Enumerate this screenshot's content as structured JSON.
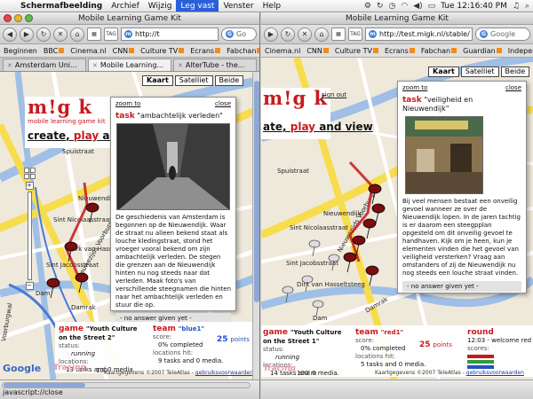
{
  "menubar": {
    "app": "Schermafbeelding",
    "items": [
      "Archief",
      "Wijzig",
      "Leg vast",
      "Venster",
      "Help"
    ],
    "active": "Leg vast",
    "clock": "Tue 12:16:40 PM"
  },
  "left_window": {
    "title": "Mobile Learning Game Kit",
    "url": "http://t",
    "search_placeholder": "Go",
    "bookmarks": [
      "Beginnen",
      "BBC",
      "Cinema.nl",
      "CNN",
      "Culture TV",
      "Ecrans",
      "Fabchan"
    ],
    "tabs": [
      "Amsterdam Uni...",
      "Mobile Learning...",
      "AlterTube - the..."
    ],
    "map_types": [
      "Kaart",
      "Satelliet",
      "Beide"
    ],
    "logo": {
      "text": "m!g k",
      "subtitle": "mobile learning game kit",
      "create": "create",
      "play": "play",
      "and": "an"
    },
    "streets": [
      "Sint Nicolaasstraat",
      "Nieuwendijk",
      "Dirk van Hasseltsteeg",
      "Sint Jacobsstraat",
      "Spuistraat",
      "Nieuwezijds Voorburgwal",
      "Damrak",
      "Dam",
      "Voorburgwal"
    ],
    "popup": {
      "zoom": "zoom to",
      "close": "close",
      "task_word": "task",
      "task_name": "\"ambachtelijk verleden\"",
      "body": "De geschiedenis van Amsterdam is begonnen op de Nieuwendijk. Waar de straat nu alleen bekend staat als louche kledingstraat, stond het vroeger vooral bekend om zijn ambachtelijk verleden. De stegen die grenzen aan de Nieuwendijk hinten nu nog steeds naar dat verleden. Maak foto's van verschillende steegnamen die hinten naar het ambachtelijk verleden en stuur die op.",
      "answer": "- no answer given yet -"
    },
    "info": {
      "game_label": "game",
      "game_name": "\"Youth Culture on the Street 2\"",
      "status_label": "status:",
      "status_value": "running",
      "locations_label": "locations:",
      "locations_value": "13 tasks and 0 media.",
      "team_label": "team",
      "team_name": "\"blue1\"",
      "score_label": "score:",
      "score_value": "0% completed",
      "hit_label": "locations hit:",
      "hit_value": "9 tasks and 0 media.",
      "points": "25",
      "points_unit": "points"
    },
    "map_footer": {
      "google": "Google",
      "tracing": "Tracing",
      "scale": "100",
      "terms": "Kaartgegevens ©2007 TeleAtlas -",
      "terms_link": "gebruiksvoorwaarden"
    },
    "status": "javascript://close"
  },
  "right_window": {
    "title": "Mobile Learning Game Kit",
    "url": "http://test.migk.nl/stable/",
    "search_placeholder": "Google",
    "bookmarks": [
      "Cinema.nl",
      "CNN",
      "Culture TV",
      "Ecrans",
      "Fabchan",
      "Guardian",
      "Independent"
    ],
    "map_types": [
      "Kaart",
      "Satelliet",
      "Beide"
    ],
    "logo": {
      "text": "m!g k",
      "create": "ate",
      "play": "play",
      "and": "and",
      "view": "view"
    },
    "sign_out": "sign out",
    "streets": [
      "Sint Nicolaasstraat",
      "Nieuwendijk",
      "Sint Jacobsstraat",
      "Dirk van Hasseltsteeg",
      "Spuistraat",
      "Nieuwezijds Voorburgwal",
      "Damrak",
      "Dam"
    ],
    "popup": {
      "zoom": "zoom to",
      "close": "close",
      "task_word": "task",
      "task_name": "\"veiligheid en Nieuwendijk\"",
      "body": "Bij veel mensen bestaat een onveilig gevoel wanneer ze over de Nieuwendijk lopen. In de jaren tachtig is er daarom een steegpplan opgesteld om dit onveilig gevoel te handhaven. Kijk om je heen, kun je elementen vinden die het gevoel van veiligheid versterken? Vraag aan omstanders of zij de Nieuwendijk nu nog steeds een louche straat vinden.",
      "answer": "- no answer given yet -"
    },
    "info": {
      "game_label": "game",
      "game_name": "\"Youth Culture on the Street 1\"",
      "status_label": "status:",
      "status_value": "running",
      "locations_label": "locations:",
      "locations_value": "14 tasks and 0 media.",
      "team_label": "team",
      "team_name": "\"red1\"",
      "score_label": "score:",
      "score_value": "0% completed",
      "hit_label": "locations hit:",
      "hit_value": "5 tasks and 0 media.",
      "points": "25",
      "points_unit": "points",
      "round_label": "round",
      "round_value": "12:03 - welcome red1!",
      "scores_label": "scores:"
    },
    "map_footer": {
      "tracing": "Tracing",
      "scale": "100 m",
      "terms": "Kaartgegevens ©2007 TeleAtlas -",
      "terms_link": "gebruiksvoorwaarden"
    }
  },
  "colors": {
    "brand_red": "#c8191e",
    "blue_points": "#1f52c8",
    "selection": "#2b5fd9",
    "map_road_yellow": "#f7dd4d",
    "map_water": "#9fbfe6"
  }
}
